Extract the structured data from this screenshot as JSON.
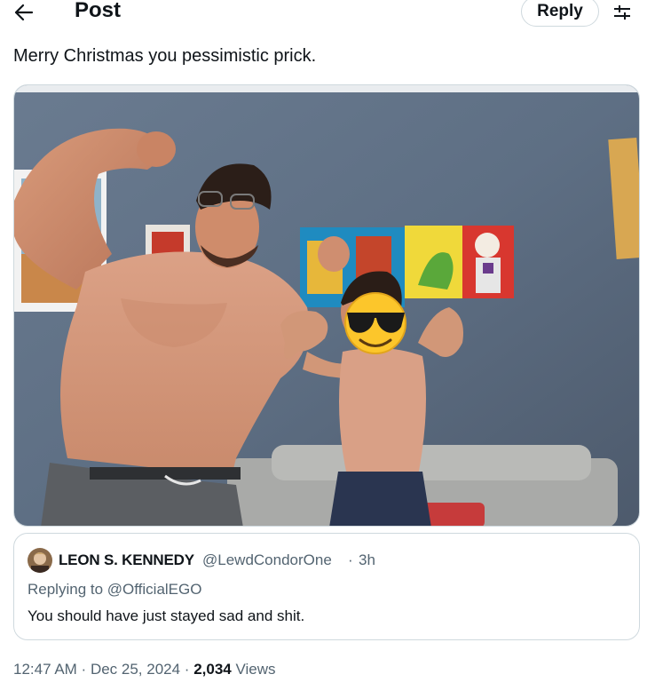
{
  "header": {
    "title": "Post",
    "reply_label": "Reply"
  },
  "tweet": {
    "text": "Merry Christmas you pessimistic prick."
  },
  "quote": {
    "name": "LEON S. KENNEDY",
    "handle": "@LewdCondorOne",
    "dot": "·",
    "time": "3h",
    "replying_prefix": "Replying to ",
    "replying_handle": "@OfficialEGO",
    "text": "You should have just stayed sad and shit."
  },
  "meta": {
    "time": "12:47 AM",
    "sep1": " · ",
    "date": "Dec 25, 2024",
    "sep2": " · ",
    "views_count": "2,034",
    "views_label": " Views"
  },
  "icons": {
    "back": "back-arrow-icon",
    "filter": "sliders-icon",
    "emoji": "sunglasses-emoji-icon"
  },
  "colors": {
    "text": "#0f1419",
    "secondary": "#536471",
    "border": "#cfd9de"
  }
}
